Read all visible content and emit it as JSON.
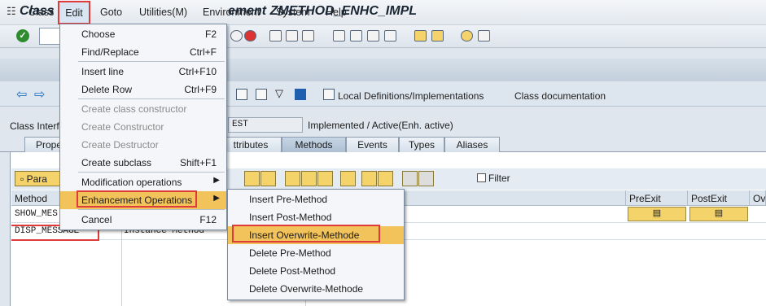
{
  "menubar": {
    "items": [
      "Class",
      "Edit",
      "Goto",
      "Utilities(M)",
      "Environment",
      "System",
      "Help"
    ]
  },
  "title": "Class Builder: Display Enhancement ZMETHOD_ENHC_IMPL",
  "title_left": "Class",
  "title_right": "ement ZMETHOD_ENHC_IMPL",
  "app_toolbar": {
    "local_defs": "Local Definitions/Implementations",
    "class_doc": "Class documentation"
  },
  "class_interface": {
    "label": "Class Interf",
    "value": "EST",
    "status": "Implemented / Active(Enh. active)"
  },
  "tabs": [
    "Prope",
    "ttributes",
    "Methods",
    "Events",
    "Types",
    "Aliases"
  ],
  "active_tab": "Methods",
  "grid": {
    "param_button": "Para",
    "filter_label": "Filter",
    "headers": {
      "method": "Method",
      "preexit": "PreExit",
      "postexit": "PostExit",
      "more": "Ov"
    },
    "rows": [
      {
        "method": "SHOW_MES",
        "type": ""
      },
      {
        "method": "DISP_MESSAGE",
        "type": "Instance Method"
      }
    ]
  },
  "edit_menu": {
    "items": [
      {
        "label": "Choose",
        "shortcut": "F2",
        "disabled": false
      },
      {
        "label": "Find/Replace",
        "shortcut": "Ctrl+F",
        "disabled": false
      },
      {
        "label": "Insert line",
        "shortcut": "Ctrl+F10",
        "disabled": false
      },
      {
        "label": "Delete Row",
        "shortcut": "Ctrl+F9",
        "disabled": false
      },
      {
        "label": "Create class constructor",
        "shortcut": "",
        "disabled": true
      },
      {
        "label": "Create Constructor",
        "shortcut": "",
        "disabled": true
      },
      {
        "label": "Create Destructor",
        "shortcut": "",
        "disabled": true
      },
      {
        "label": "Create subclass",
        "shortcut": "Shift+F1",
        "disabled": false
      },
      {
        "label": "Modification operations",
        "shortcut": "",
        "disabled": false
      },
      {
        "label": "Enhancement Operations",
        "shortcut": "",
        "disabled": false
      },
      {
        "label": "Cancel",
        "shortcut": "F12",
        "disabled": false
      }
    ]
  },
  "enh_submenu": {
    "items": [
      "Insert Pre-Method",
      "Insert Post-Method",
      "Insert Overwrite-Methode",
      "Delete Pre-Method",
      "Delete Post-Method",
      "Delete Overwrite-Methode"
    ],
    "highlighted_index": 2
  },
  "colors": {
    "highlight": "#f2c35a",
    "annotation_red": "#e03b3b",
    "yellow_button": "#f4d36b"
  }
}
